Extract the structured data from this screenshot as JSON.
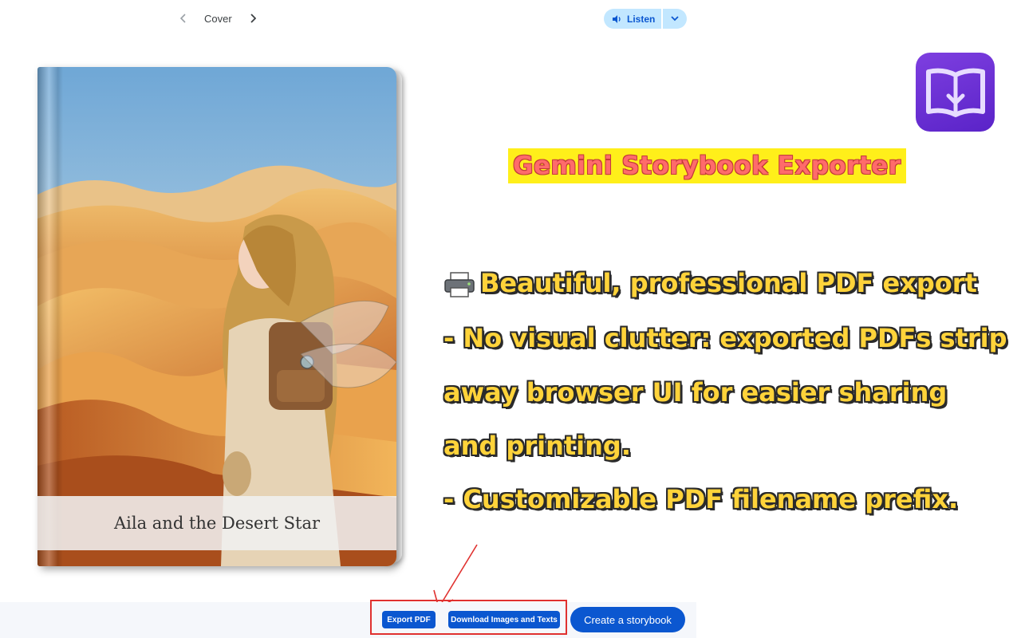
{
  "nav": {
    "prev_icon": "chevron-left-icon",
    "label": "Cover",
    "next_icon": "chevron-right-icon"
  },
  "listen": {
    "label": "Listen",
    "speaker_icon": "speaker-icon",
    "dropdown_icon": "chevron-down-icon"
  },
  "book": {
    "title": "Aila and the Desert Star"
  },
  "app_icon": "book-download-icon",
  "promo": {
    "title": "Gemini Storybook Exporter",
    "lines": [
      "Beautiful, professional PDF export",
      "- No visual clutter: exported PDFs strip",
      "away browser UI for easier sharing",
      "and printing.",
      "- Customizable PDF filename prefix."
    ],
    "printer_icon": "printer-icon"
  },
  "bottom": {
    "export_pdf": "Export PDF",
    "download": "Download Images and Texts",
    "create": "Create a storybook"
  },
  "colors": {
    "accent_blue": "#0b57d0",
    "listen_bg": "#c2e7ff",
    "highlight_red": "#e0312f",
    "promo_yellow": "#ffd33a",
    "title_bg": "#ffef1a",
    "title_text": "#ff6b6b"
  }
}
